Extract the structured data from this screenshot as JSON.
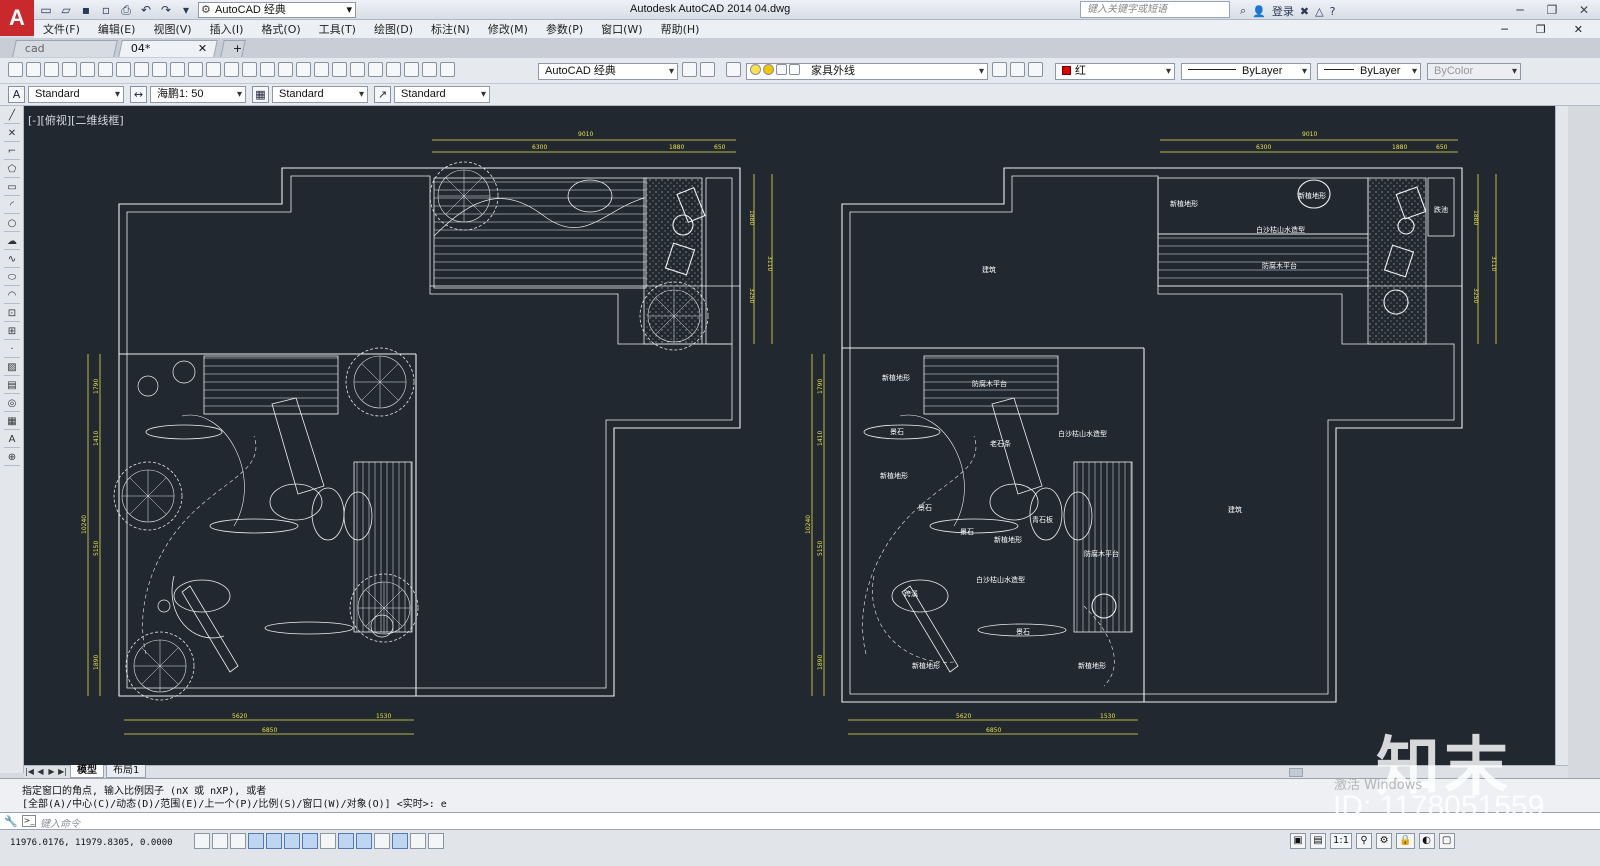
{
  "titlebar": {
    "app_title": "Autodesk AutoCAD 2014    04.dwg",
    "workspace": "AutoCAD 经典",
    "search_placeholder": "键入关键字或短语",
    "signin": "登录"
  },
  "menu": [
    "文件(F)",
    "编辑(E)",
    "视图(V)",
    "插入(I)",
    "格式(O)",
    "工具(T)",
    "绘图(D)",
    "标注(N)",
    "修改(M)",
    "参数(P)",
    "窗口(W)",
    "帮助(H)"
  ],
  "file_tabs": [
    {
      "label": "cad"
    },
    {
      "label": "04*"
    }
  ],
  "toolbar": {
    "workspace_combo": "AutoCAD 经典",
    "layer": "家具外线",
    "color": "红",
    "linetype": "ByLayer",
    "lineweight": "ByLayer",
    "plotstyle": "ByColor",
    "text_style": "Standard",
    "dim_scale": "海鹏1: 50",
    "table_style": "Standard",
    "multileader_style": "Standard"
  },
  "viewport_label": "[-][俯视][二维线框]",
  "drawing": {
    "dims_top": [
      "9010",
      "6300",
      "1880",
      "650"
    ],
    "dims_right": [
      "1880",
      "3110",
      "3250"
    ],
    "dims_left": [
      "1790",
      "1410",
      "10240",
      "5150",
      "1890"
    ],
    "dims_bottom": [
      "5620",
      "1530",
      "6850"
    ],
    "right_labels": [
      {
        "text": "新植地形",
        "pos": "a"
      },
      {
        "text": "新植地形",
        "pos": "b"
      },
      {
        "text": "白沙枯山水造型",
        "pos": "c"
      },
      {
        "text": "防腐木平台",
        "pos": "d"
      },
      {
        "text": "跌池",
        "pos": "e"
      },
      {
        "text": "建筑",
        "pos": "f"
      },
      {
        "text": "新植地形",
        "pos": "g"
      },
      {
        "text": "防腐木平台",
        "pos": "h"
      },
      {
        "text": "景石",
        "pos": "i"
      },
      {
        "text": "老石条",
        "pos": "j"
      },
      {
        "text": "白沙枯山水造型",
        "pos": "k"
      },
      {
        "text": "新植地形",
        "pos": "l"
      },
      {
        "text": "景石",
        "pos": "m"
      },
      {
        "text": "青石板",
        "pos": "n"
      },
      {
        "text": "景石",
        "pos": "o"
      },
      {
        "text": "新植地形",
        "pos": "p"
      },
      {
        "text": "防腐木平台",
        "pos": "q"
      },
      {
        "text": "白沙枯山水造型",
        "pos": "r"
      },
      {
        "text": "跨溪",
        "pos": "s"
      },
      {
        "text": "景石",
        "pos": "t"
      },
      {
        "text": "新植地形",
        "pos": "u"
      },
      {
        "text": "新植地形",
        "pos": "v"
      },
      {
        "text": "建筑",
        "pos": "w"
      }
    ]
  },
  "layout_tabs": [
    {
      "label": "模型"
    },
    {
      "label": "布局1"
    }
  ],
  "command": {
    "line1": "指定窗口的角点, 输入比例因子 (nX 或 nXP), 或者",
    "line2": "[全部(A)/中心(C)/动态(D)/范围(E)/上一个(P)/比例(S)/窗口(W)/对象(O)] <实时>: e",
    "placeholder": "键入命令"
  },
  "status": {
    "coords": "11976.0176, 11979.8305, 0.0000",
    "annotation_scale": "1:1"
  },
  "watermark": {
    "logo": "知末",
    "id": "ID: 1178051559",
    "activate": "激活 Windows"
  }
}
